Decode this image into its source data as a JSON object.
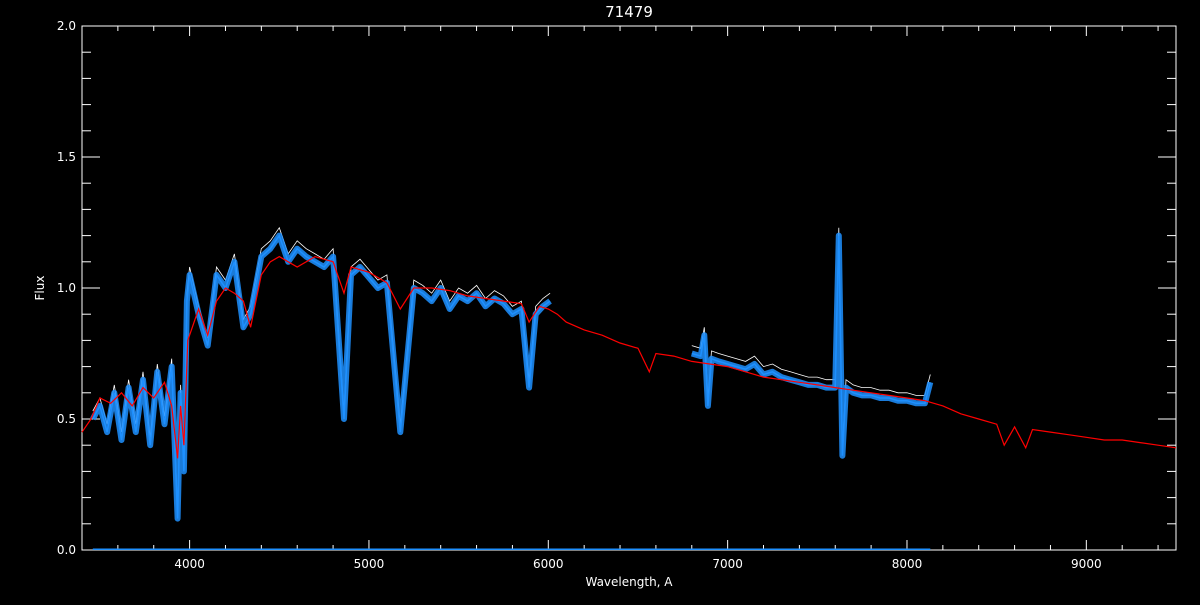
{
  "chart_data": {
    "type": "line",
    "title": "71479",
    "xlabel": "Wavelength, A",
    "ylabel": "Flux",
    "xlim": [
      3400,
      9500
    ],
    "ylim": [
      0.0,
      2.0
    ],
    "x_ticks": [
      4000,
      5000,
      6000,
      7000,
      8000,
      9000
    ],
    "x_tick_labels": [
      "4000",
      "5000",
      "6000",
      "7000",
      "8000",
      "9000"
    ],
    "y_ticks": [
      0.0,
      0.5,
      1.0,
      1.5,
      2.0
    ],
    "y_tick_labels": [
      "0.0",
      "0.5",
      "1.0",
      "1.5",
      "2.0"
    ],
    "grid": false,
    "legend": "none",
    "colors": {
      "background": "#000000",
      "axes": "#ffffff",
      "observed_spectrum": "#1e90ff",
      "observed_envelope": "#ffffff",
      "model_spectrum": "#ff0000",
      "error_baseline": "#1e90ff"
    },
    "series": [
      {
        "role": "model",
        "color": "#ff0000",
        "x": [
          3400,
          3450,
          3500,
          3560,
          3620,
          3680,
          3740,
          3800,
          3860,
          3900,
          3933,
          3950,
          3968,
          3990,
          4050,
          4101,
          4150,
          4200,
          4250,
          4300,
          4340,
          4400,
          4450,
          4500,
          4550,
          4600,
          4700,
          4800,
          4861,
          4900,
          5000,
          5100,
          5175,
          5250,
          5350,
          5450,
          5550,
          5650,
          5750,
          5850,
          5893,
          5950,
          6000,
          6050,
          6100,
          6200,
          6300,
          6400,
          6500,
          6563,
          6600,
          6700,
          6800,
          6900,
          7000,
          7100,
          7200,
          7300,
          7400,
          7500,
          7600,
          7700,
          7800,
          7900,
          8000,
          8100,
          8200,
          8300,
          8400,
          8500,
          8542,
          8600,
          8662,
          8700,
          8800,
          8900,
          9000,
          9100,
          9200,
          9300,
          9400,
          9500
        ],
        "y": [
          0.45,
          0.5,
          0.58,
          0.56,
          0.6,
          0.55,
          0.62,
          0.58,
          0.64,
          0.55,
          0.35,
          0.55,
          0.4,
          0.8,
          0.92,
          0.82,
          0.95,
          1.0,
          0.98,
          0.95,
          0.85,
          1.05,
          1.1,
          1.12,
          1.1,
          1.08,
          1.12,
          1.1,
          0.98,
          1.08,
          1.06,
          1.02,
          0.92,
          1.0,
          1.0,
          0.99,
          0.97,
          0.96,
          0.95,
          0.94,
          0.87,
          0.93,
          0.92,
          0.9,
          0.87,
          0.84,
          0.82,
          0.79,
          0.77,
          0.68,
          0.75,
          0.74,
          0.72,
          0.71,
          0.7,
          0.68,
          0.66,
          0.65,
          0.64,
          0.63,
          0.62,
          0.61,
          0.6,
          0.59,
          0.58,
          0.57,
          0.55,
          0.52,
          0.5,
          0.48,
          0.4,
          0.47,
          0.39,
          0.46,
          0.45,
          0.44,
          0.43,
          0.42,
          0.42,
          0.41,
          0.4,
          0.39
        ]
      },
      {
        "role": "observed",
        "color": "#1e90ff",
        "segments": [
          {
            "x": [
              3460,
              3500,
              3540,
              3580,
              3620,
              3660,
              3700,
              3740,
              3780,
              3820,
              3860,
              3900,
              3933,
              3950,
              3968,
              3985,
              4000,
              4050,
              4101,
              4150,
              4200,
              4250,
              4300,
              4340,
              4400,
              4450,
              4500,
              4550,
              4600,
              4650,
              4700,
              4750,
              4800,
              4861,
              4900,
              4950,
              5000,
              5050,
              5100,
              5175,
              5250,
              5300,
              5350,
              5400,
              5450,
              5500,
              5550,
              5600,
              5650,
              5700,
              5750,
              5800,
              5850,
              5893,
              5930,
              5970,
              6010
            ],
            "y": [
              0.5,
              0.55,
              0.45,
              0.6,
              0.42,
              0.62,
              0.45,
              0.65,
              0.4,
              0.68,
              0.48,
              0.7,
              0.12,
              0.6,
              0.3,
              0.95,
              1.05,
              0.9,
              0.78,
              1.05,
              1.0,
              1.1,
              0.85,
              0.9,
              1.12,
              1.15,
              1.2,
              1.1,
              1.15,
              1.12,
              1.1,
              1.08,
              1.12,
              0.5,
              1.05,
              1.08,
              1.04,
              1.0,
              1.02,
              0.45,
              1.0,
              0.98,
              0.95,
              1.0,
              0.92,
              0.97,
              0.95,
              0.98,
              0.93,
              0.96,
              0.94,
              0.9,
              0.92,
              0.62,
              0.9,
              0.93,
              0.95
            ]
          },
          {
            "x": [
              6800,
              6850,
              6870,
              6890,
              6910,
              6950,
              7000,
              7050,
              7100,
              7150,
              7200,
              7250,
              7300,
              7350,
              7400,
              7450,
              7500,
              7550,
              7600,
              7620,
              7640,
              7660,
              7700,
              7750,
              7800,
              7850,
              7900,
              7950,
              8000,
              8050,
              8100,
              8130
            ],
            "y": [
              0.75,
              0.74,
              0.82,
              0.55,
              0.73,
              0.72,
              0.71,
              0.7,
              0.69,
              0.71,
              0.67,
              0.68,
              0.66,
              0.65,
              0.64,
              0.63,
              0.63,
              0.62,
              0.62,
              1.2,
              0.36,
              0.62,
              0.6,
              0.59,
              0.59,
              0.58,
              0.58,
              0.57,
              0.57,
              0.56,
              0.56,
              0.64
            ]
          }
        ]
      },
      {
        "role": "error",
        "color": "#1e90ff",
        "x": [
          3460,
          8130
        ],
        "y": [
          0.0,
          0.0
        ]
      }
    ]
  }
}
